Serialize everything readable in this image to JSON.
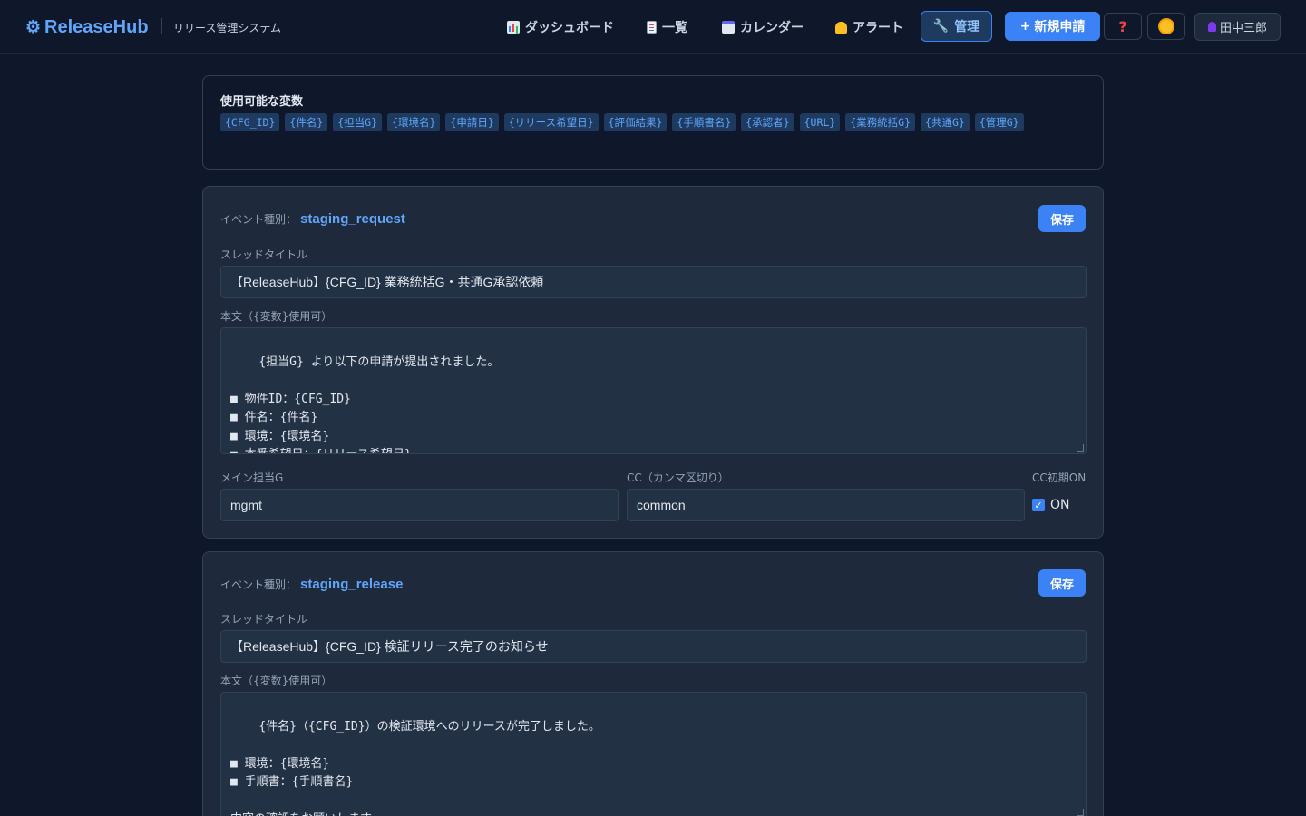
{
  "header": {
    "brand": "ReleaseHub",
    "subtitle": "リリース管理システム",
    "nav": {
      "dashboard": "ダッシュボード",
      "list": "一覧",
      "calendar": "カレンダー",
      "alert": "アラート"
    },
    "manage_label": "管理",
    "new_request_label": "新規申請",
    "help_glyph": "?",
    "user_name": "田中三郎"
  },
  "variables": {
    "title": "使用可能な変数",
    "items": [
      "{CFG_ID}",
      "{件名}",
      "{担当G}",
      "{環境名}",
      "{申請日}",
      "{リリース希望日}",
      "{評価結果}",
      "{手順書名}",
      "{承認者}",
      "{URL}",
      "{業務統括G}",
      "{共通G}",
      "{管理G}"
    ]
  },
  "events": [
    {
      "type_label": "イベント種別：",
      "type_name": "staging_request",
      "save_label": "保存",
      "thread_title_label": "スレッドタイトル",
      "thread_title": "【ReleaseHub】{CFG_ID} 業務統括G・共通G承認依頼",
      "body_label": "本文（{変数}使用可）",
      "body": "{担当G} より以下の申請が提出されました。\n\n■ 物件ID：{CFG_ID}\n■ 件名：{件名}\n■ 環境：{環境名}\n■ 本番希望日：{リリース希望日}\n■ 保守評価結果：{評価結果}",
      "main_group_label": "メイン担当G",
      "main_group": "mgmt",
      "cc_label": "CC（カンマ区切り）",
      "cc": "common",
      "cc_default_label": "CC初期ON",
      "cc_default_value": "ON"
    },
    {
      "type_label": "イベント種別：",
      "type_name": "staging_release",
      "save_label": "保存",
      "thread_title_label": "スレッドタイトル",
      "thread_title": "【ReleaseHub】{CFG_ID} 検証リリース完了のお知らせ",
      "body_label": "本文（{変数}使用可）",
      "body": "{件名}（{CFG_ID}）の検証環境へのリリースが完了しました。\n\n■ 環境：{環境名}\n■ 手順書：{手順書名}\n\n内容の確認をお願いします。\n{URL}"
    }
  ],
  "colors": {
    "background": "#0f172a",
    "card": "#1e293b",
    "accent": "#3b82f6",
    "accent_text": "#60a5fa"
  }
}
